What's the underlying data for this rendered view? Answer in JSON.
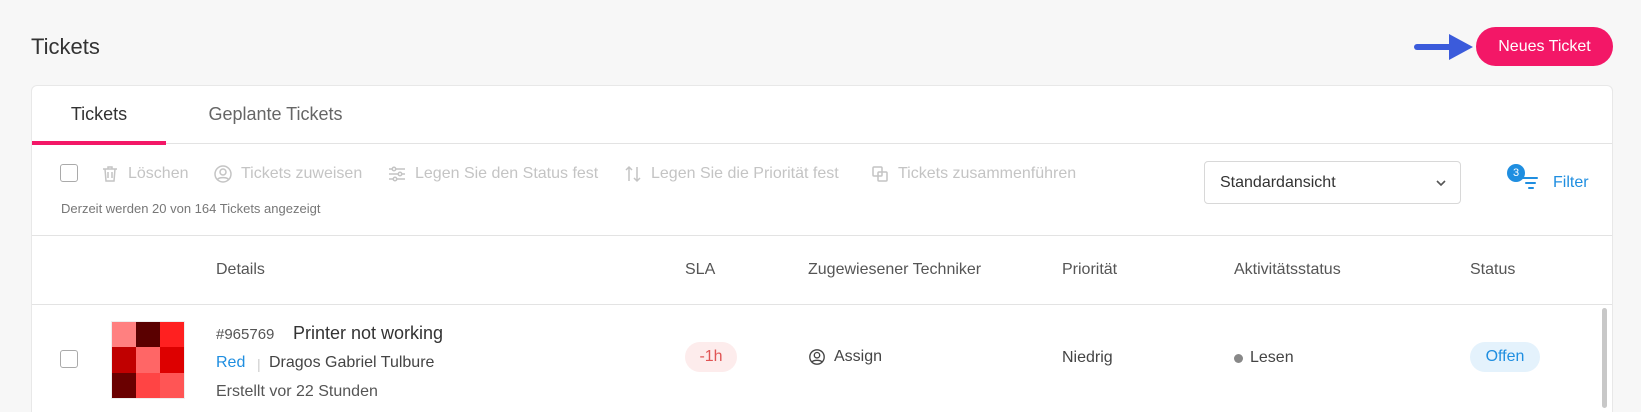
{
  "page": {
    "title": "Tickets",
    "new_ticket_label": "Neues Ticket",
    "accent_color": "#f31767",
    "link_color": "#1f8ee0"
  },
  "tabs": [
    {
      "label": "Tickets",
      "active": true
    },
    {
      "label": "Geplante Tickets",
      "active": false
    }
  ],
  "toolbar": {
    "actions": [
      {
        "label": "Löschen",
        "icon": "trash-icon"
      },
      {
        "label": "Tickets zuweisen",
        "icon": "user-circle-icon"
      },
      {
        "label": "Legen Sie den Status fest",
        "icon": "sliders-icon"
      },
      {
        "label": "Legen Sie die Priorität fest",
        "icon": "sort-arrows-icon"
      },
      {
        "label": "Tickets zusammenführen",
        "icon": "merge-icon"
      }
    ],
    "count_text": "Derzeit werden 20 von 164 Tickets angezeigt",
    "view_selected": "Standardansicht",
    "filter_label": "Filter",
    "filter_count": "3"
  },
  "table": {
    "headers": [
      "Details",
      "SLA",
      "Zugewiesener Techniker",
      "Priorität",
      "Aktivitätsstatus",
      "Status"
    ],
    "rows": [
      {
        "id": "#965769",
        "subject": "Printer not working",
        "tag": "Red",
        "requester": "Dragos Gabriel Tulbure",
        "created": "Erstellt vor 22 Stunden",
        "sla": "-1h",
        "technician": "Assign",
        "priority": "Niedrig",
        "activity": "Lesen",
        "status": "Offen",
        "thumbnail_colors": [
          "#ff8080",
          "#5a0000",
          "#ff2020",
          "#c00000",
          "#ff6666",
          "#dd0000",
          "#6a0000",
          "#ff4444",
          "#ff5555"
        ]
      }
    ]
  }
}
